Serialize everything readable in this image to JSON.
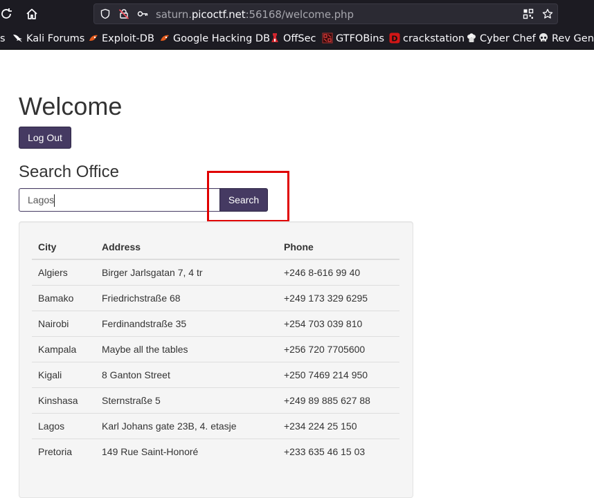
{
  "browser": {
    "url": {
      "prefix": "saturn.",
      "domain": "picoctf.net",
      "suffix": ":56168/welcome.php"
    },
    "icons": [
      "reload-icon",
      "home-icon",
      "shield-icon",
      "insecure-lock-icon",
      "key-icon",
      "qr-code-icon",
      "bookmark-star-icon"
    ],
    "bookmarks": [
      {
        "label": "s",
        "icon": "none"
      },
      {
        "label": "Kali Forums",
        "icon": "kali-dragon-icon"
      },
      {
        "label": "Exploit-DB",
        "icon": "exploit-db-icon"
      },
      {
        "label": "Google Hacking DB",
        "icon": "ghdb-icon"
      },
      {
        "label": "OffSec",
        "icon": "offsec-icon"
      },
      {
        "label": "GTFOBins",
        "icon": "gtfobins-icon"
      },
      {
        "label": "crackstation",
        "icon": "crackstation-icon"
      },
      {
        "label": "Cyber Chef",
        "icon": "cyber-chef-icon"
      },
      {
        "label": "Rev Gen",
        "icon": "skull-icon"
      }
    ]
  },
  "page": {
    "title": "Welcome",
    "logout_label": "Log Out",
    "search_title": "Search Office",
    "search_value": "Lagos",
    "search_button": "Search",
    "accent_color": "#453a62",
    "annotation_color": "#e00000"
  },
  "table": {
    "headers": [
      "City",
      "Address",
      "Phone"
    ],
    "rows": [
      [
        "Algiers",
        "Birger Jarlsgatan 7, 4 tr",
        "+246 8-616 99 40"
      ],
      [
        "Bamako",
        "Friedrichstraße 68",
        "+249 173 329 6295"
      ],
      [
        "Nairobi",
        "Ferdinandstraße 35",
        "+254 703 039 810"
      ],
      [
        "Kampala",
        "Maybe all the tables",
        "+256 720 7705600"
      ],
      [
        "Kigali",
        "8 Ganton Street",
        "+250 7469 214 950"
      ],
      [
        "Kinshasa",
        "Sternstraße 5",
        "+249 89 885 627 88"
      ],
      [
        "Lagos",
        "Karl Johans gate 23B, 4. etasje",
        "+234 224 25 150"
      ],
      [
        "Pretoria",
        "149 Rue Saint-Honoré",
        "+233 635 46 15 03"
      ]
    ]
  }
}
